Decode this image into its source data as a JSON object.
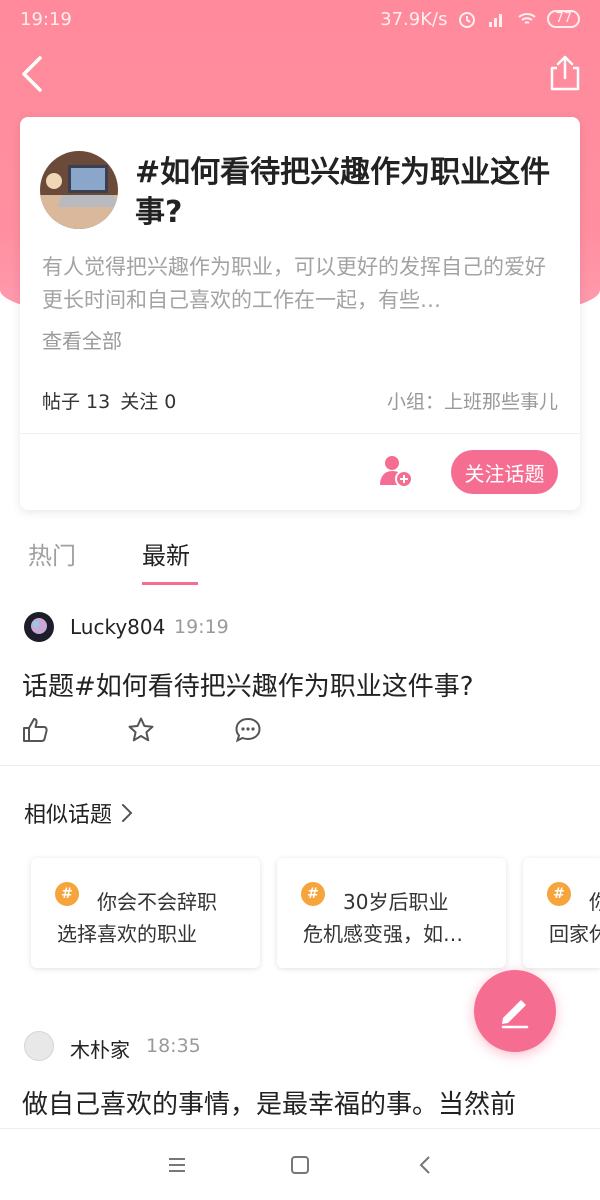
{
  "status_bar": {
    "time": "19:19",
    "network_speed": "37.9K/s",
    "battery": "77"
  },
  "topic": {
    "title": "#如何看待把兴趣作为职业这件事?",
    "description": "有人觉得把兴趣作为职业，可以更好的发挥自己的爱好更长时间和自己喜欢的工作在一起，有些…",
    "see_all": "查看全部",
    "posts_label": "帖子 13",
    "follows_label": "关注 0",
    "group": "小组：上班那些事儿",
    "follow_button": "关注话题"
  },
  "tabs": [
    {
      "label": "热门",
      "active": false
    },
    {
      "label": "最新",
      "active": true
    }
  ],
  "posts": [
    {
      "user": "Lucky804",
      "time": "19:19",
      "text": "话题#如何看待把兴趣作为职业这件事?"
    },
    {
      "user": "木朴家",
      "time": "18:35",
      "text": "做自己喜欢的事情，是最幸福的事。当然前"
    }
  ],
  "similar": {
    "title": "相似话题",
    "items": [
      {
        "line1": "你会不会辞职",
        "line2": "选择喜欢的职业"
      },
      {
        "line1": "30岁后职业",
        "line2": "危机感变强，如…"
      },
      {
        "line1": "你",
        "line2": "回家休"
      }
    ]
  },
  "colors": {
    "accent": "#f56e92",
    "hero": "#ff8fa0",
    "hash_badge": "#f5a53b"
  },
  "icons": [
    "back-icon",
    "share-icon",
    "person-add-icon",
    "like-icon",
    "star-icon",
    "comment-icon",
    "chevron-right-icon",
    "hash-icon",
    "edit-icon",
    "menu-icon",
    "home-icon",
    "nav-back-icon"
  ]
}
